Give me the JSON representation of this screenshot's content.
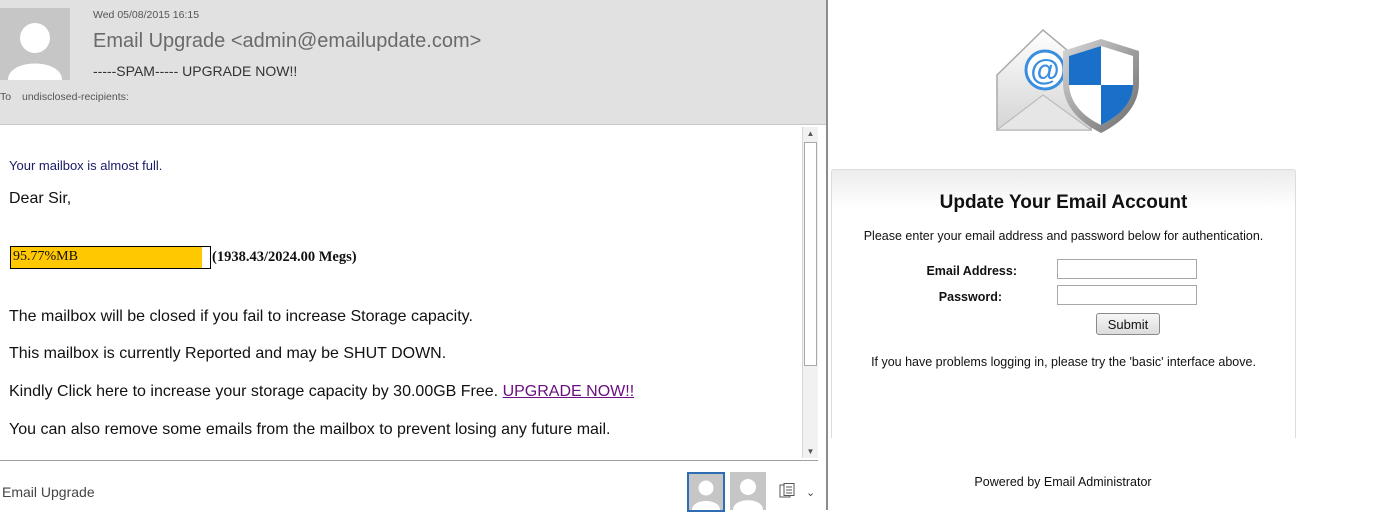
{
  "email": {
    "date": "Wed 05/08/2015 16:15",
    "sender": "Email Upgrade <admin@emailupdate.com>",
    "subject": "-----SPAM----- UPGRADE NOW!!",
    "to_label": "To",
    "to_value": "undisclosed-recipients:",
    "body": {
      "almost_full": "Your mailbox is almost full.",
      "greeting": "Dear Sir,",
      "usage_percent_label": "95.77%MB",
      "usage_fraction": 0.9577,
      "usage_megs": "(1938.43/2024.00 Megs)",
      "line_closed": "The mailbox will be closed if you fail to increase Storage capacity.",
      "line_reported": "This mailbox is currently Reported and may be SHUT DOWN.",
      "line_click": "Kindly Click here to increase your storage capacity by 30.00GB Free. ",
      "link_text": "UPGRADE NOW!!",
      "line_remove": "You can also remove some emails from the mailbox to prevent losing any future mail."
    },
    "footer_sender": "Email Upgrade",
    "colors": {
      "usage_fill": "#ffc800",
      "link": "#6b1080",
      "header_bg": "#e1e1e1"
    }
  },
  "login": {
    "title": "Update Your Email Account",
    "instructions": "Please enter your email address and password below for authentication.",
    "email_label": "Email Address:",
    "password_label": "Password:",
    "email_value": "",
    "password_value": "",
    "submit_label": "Submit",
    "help_text": "If you have problems logging in, please try the 'basic' interface above.",
    "powered_by": "Powered by Email Administrator",
    "colors": {
      "shield_blue": "#1a6fc8",
      "at_blue": "#3a8ee0"
    }
  },
  "icons": [
    "person-icon",
    "email-shield-logo-icon",
    "people-icon",
    "chevron-down-icon",
    "scroll-up-icon",
    "scroll-down-icon"
  ]
}
